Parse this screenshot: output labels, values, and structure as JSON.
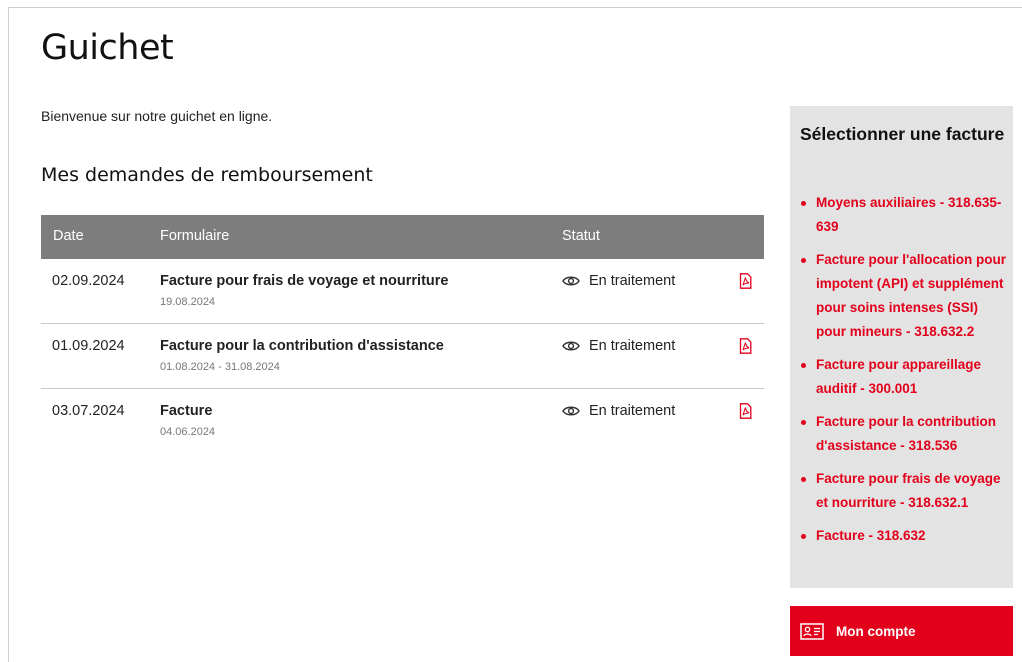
{
  "page": {
    "title": "Guichet",
    "welcome": "Bienvenue sur notre guichet en ligne.",
    "section_title": "Mes demandes de remboursement"
  },
  "table": {
    "headers": {
      "date": "Date",
      "form": "Formulaire",
      "status": "Statut"
    },
    "rows": [
      {
        "date": "02.09.2024",
        "title": "Facture pour frais de voyage et nourriture",
        "sub": "19.08.2024",
        "status": "En traitement"
      },
      {
        "date": "01.09.2024",
        "title": "Facture pour la contribution d'assistance",
        "sub": "01.08.2024 - 31.08.2024",
        "status": "En traitement"
      },
      {
        "date": "03.07.2024",
        "title": "Facture",
        "sub": "04.06.2024",
        "status": "En traitement"
      }
    ],
    "status_icon": "eye-icon",
    "action_icon": "pdf-icon"
  },
  "sidebar": {
    "title": "Sélectionner une facture",
    "items": [
      "Moyens auxiliaires - 318.635-639",
      "Facture pour l'allocation pour impotent (API) et supplément pour soins intenses (SSI) pour mineurs - 318.632.2",
      "Facture pour appareillage auditif - 300.001",
      "Facture pour la contribution d'assistance - 318.536",
      "Facture pour frais de voyage et nourriture - 318.632.1",
      "Facture - 318.632"
    ]
  },
  "account": {
    "label": "Mon compte",
    "icon": "id-card-icon"
  },
  "colors": {
    "accent": "#e2001a",
    "table_header": "#7d7d7d",
    "sidebar_bg": "#e3e3e3"
  }
}
